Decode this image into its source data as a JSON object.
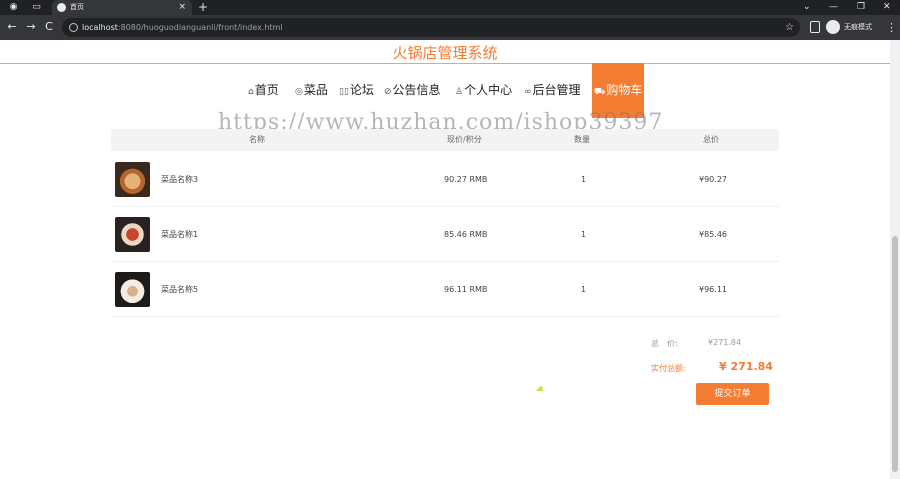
{
  "browser": {
    "tab_title": "首页",
    "tab_close": "×",
    "new_tab": "+",
    "url_host": "localhost",
    "url_rest": ":8080/huoguodianguanli/front/index.html",
    "incognito_label": "无痕模式",
    "nav_back": "←",
    "nav_forward": "→",
    "nav_reload": "C",
    "star": "☆",
    "more": "⋮",
    "win_min": "—",
    "win_max": "❐",
    "win_close": "✕",
    "win_chevron": "⌄"
  },
  "site": {
    "title": "火锅店管理系统"
  },
  "nav": {
    "items": [
      {
        "icon": "⌂",
        "label": "首页"
      },
      {
        "icon": "◎",
        "label": "菜品"
      },
      {
        "icon": "▯▯",
        "label": "论坛"
      },
      {
        "icon": "⊘",
        "label": "公告信息"
      },
      {
        "icon": "♙",
        "label": "个人中心"
      },
      {
        "icon": "∞",
        "label": "后台管理"
      },
      {
        "icon": "⛟",
        "label": "购物车"
      }
    ],
    "active_index": 6
  },
  "watermark": "https://www.huzhan.com/ishop39397",
  "cart": {
    "headers": {
      "name": "名称",
      "price": "现价/积分",
      "qty": "数量",
      "total": "总价"
    },
    "rows": [
      {
        "name": "菜品名称3",
        "price": "90.27 RMB",
        "qty": "1",
        "total": "¥90.27"
      },
      {
        "name": "菜品名称1",
        "price": "85.46 RMB",
        "qty": "1",
        "total": "¥85.46"
      },
      {
        "name": "菜品名称5",
        "price": "96.11 RMB",
        "qty": "1",
        "total": "¥96.11"
      }
    ],
    "summary": {
      "total_label": "总　价:",
      "total_value": "¥271.84",
      "pay_label": "实付总额:",
      "pay_value": "¥ 271.84"
    },
    "submit_label": "提交订单"
  },
  "colors": {
    "accent": "#f57c33"
  }
}
